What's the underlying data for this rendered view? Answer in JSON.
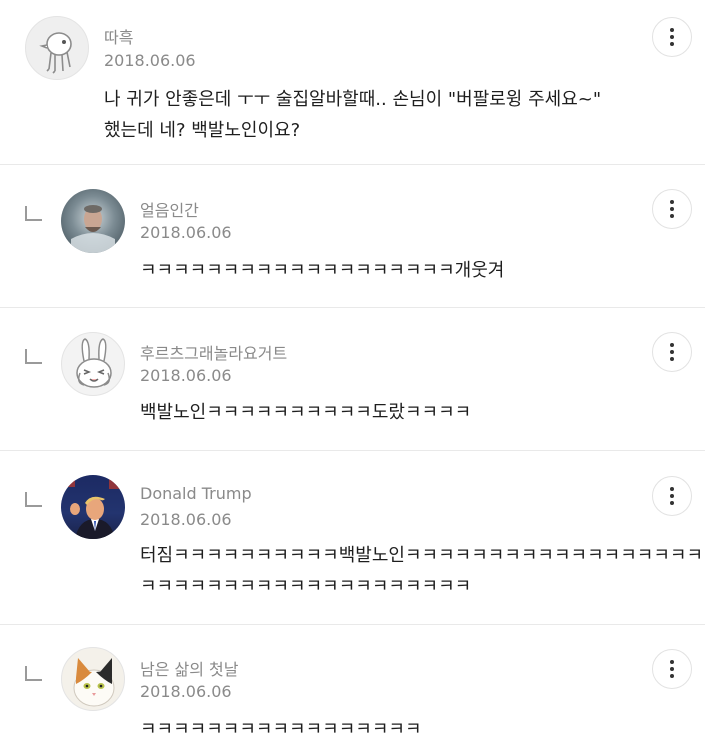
{
  "comments": [
    {
      "author": "따흑",
      "date": "2018.06.06",
      "text_lines": [
        "나 귀가 안좋은데 ㅜㅜ 술집알바할때.. 손님이 \"버팔로윙 주세요~\"",
        "했는데 네? 백발노인이요?"
      ],
      "avatar": "mascot-avatar"
    },
    {
      "author": "얼음인간",
      "date": "2018.06.06",
      "text_lines": [
        "ㅋㅋㅋㅋㅋㅋㅋㅋㅋㅋㅋㅋㅋㅋㅋㅋㅋㅋㅋ개웃겨"
      ],
      "avatar": "ice-bath-photo-avatar"
    },
    {
      "author": "후르츠그래놀라요거트",
      "date": "2018.06.06",
      "text_lines": [
        "백발노인ㅋㅋㅋㅋㅋㅋㅋㅋㅋㅋ도랐ㅋㅋㅋㅋ"
      ],
      "avatar": "rabbit-avatar"
    },
    {
      "author": "Donald Trump",
      "date": "2018.06.06",
      "text_lines": [
        "터짐ㅋㅋㅋㅋㅋㅋㅋㅋㅋㅋ백발노인ㅋㅋㅋㅋㅋㅋㅋㅋㅋㅋㅋㅋㅋㅋㅋㅋㅋㅋㅋ",
        "ㅋㅋㅋㅋㅋㅋㅋㅋㅋㅋㅋㅋㅋㅋㅋㅋㅋㅋㅋㅋ"
      ],
      "avatar": "man-in-suit-photo-avatar"
    },
    {
      "author": "남은 삶의 첫날",
      "date": "2018.06.06",
      "text_lines": [
        "ㅋㅋㅋㅋㅋㅋㅋㅋㅋㅋㅋㅋㅋㅋㅋㅋㅋ"
      ],
      "avatar": "calico-cat-avatar"
    }
  ],
  "icons": {
    "more": "more-vertical-icon",
    "reply": "reply-arrow-icon"
  }
}
